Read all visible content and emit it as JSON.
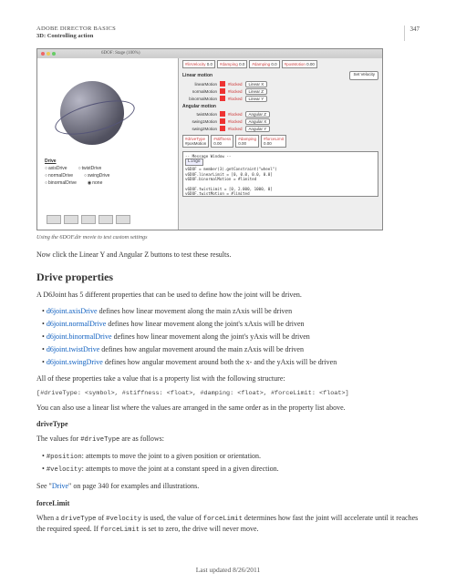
{
  "header": {
    "title": "ADOBE DIRECTOR BASICS",
    "subtitle": "3D: Controlling action",
    "page": "347"
  },
  "screenshot": {
    "window_title": "6DOF: Stage (100%)",
    "readouts": {
      "linVelocity": {
        "label": "#linVelocity",
        "val": "0.0"
      },
      "damping1": {
        "label": "#damping",
        "val": "0.0"
      },
      "damping2": {
        "label": "#damping",
        "val": "0.0"
      },
      "posMotion": {
        "label": "#posMotion",
        "val": "0.00"
      }
    },
    "linear": {
      "title": "Linear motion",
      "setBtn": "Set Velocity",
      "rows": [
        {
          "label": "linearMotion",
          "locked": "#locked",
          "btn": "Linear X"
        },
        {
          "label": "normalMotion",
          "locked": "#locked",
          "btn": "Linear Z"
        },
        {
          "label": "binormalMotion",
          "locked": "#locked",
          "btn": "Linear Y"
        }
      ]
    },
    "angular": {
      "title": "Angular motion",
      "rows": [
        {
          "label": "twistMotion",
          "locked": "#locked",
          "btn": "Angular Z"
        },
        {
          "label": "swing1Motion",
          "locked": "#locked",
          "btn": "Angular X"
        },
        {
          "label": "swing2Motion",
          "locked": "#locked",
          "btn": "Angular Y"
        }
      ]
    },
    "drive": {
      "title": "Drive",
      "r1a": "axisDrive",
      "r1b": "twistDrive",
      "r2a": "normalDrive",
      "r2b": "swingDrive",
      "r3a": "binormalDrive",
      "r3b": "none"
    },
    "lower": {
      "driveType": {
        "label": "#driveType",
        "val": "#posMotion"
      },
      "stiffness": {
        "label": "#stiffness",
        "val": "0.00"
      },
      "damping": {
        "label": "#damping",
        "val": "0.00"
      },
      "forceLimit": {
        "label": "#forceLimit",
        "val": "0.00"
      }
    },
    "msg": {
      "title": "-- Message Window --",
      "dropdown": "Lingo",
      "line1": "v6DOF = member(3).getConstraint(\"wheel\")",
      "line2": "v6DOF.linearLimit = [0, 0.0, 0.0, 0.0]",
      "line3": "v6DOF.binormalMotion = #limited",
      "line4": "v6DOF.twistLimit = [0, 2.000, 1000, 0]",
      "line5": "v6DOF.twistMotion = #limited"
    }
  },
  "caption": "Using the 6DOF.dir movie to test custom settings",
  "p_intro": "Now click the Linear Y and Angular Z buttons to test these results.",
  "h2": "Drive properties",
  "p_drive": "A D6Joint has 5 different properties that can be used to define how the joint will be driven.",
  "bullets": [
    {
      "link": "d6joint.axisDrive",
      "text": " defines how linear movement along the main zAxis will be driven"
    },
    {
      "link": "d6joint.normalDrive",
      "text": " defines how linear movement along the joint's xAxis will be driven"
    },
    {
      "link": "d6joint.binormalDrive",
      "text": " defines how linear movement along the joint's yAxis will be driven"
    },
    {
      "link": "d6joint.twistDrive",
      "text": " defines how angular movement around the main zAxis will be driven"
    },
    {
      "link": "d6joint.swingDrive",
      "text": " defines how angular movement around both the x- and the yAxis will be driven"
    }
  ],
  "p_allprops": "All of these properties take a value that is a property list with the following structure:",
  "code_struct": "[#driveType: <symbol>, #stiffness: <float>, #damping: <float>, #forceLimit: <float>]",
  "p_linear": "You can also use a linear list where the values are arranged in the same order as in the property list above.",
  "subhead1": "driveType",
  "p_values": "The values for ",
  "code_dt": "#driveType",
  "p_values2": " are as follows:",
  "bullets2": [
    {
      "code": "#position",
      "text": ": attempts to move the joint to a given position or orientation."
    },
    {
      "code": "#velocity",
      "text": ": attempts to move the joint at a constant speed in a given direction."
    }
  ],
  "p_see": "See \"",
  "seelink": "Drive",
  "p_see2": "\" on page 340 for examples and illustrations.",
  "subhead2": "forceLimit",
  "p_force": "When a ",
  "code_dt2": "driveType",
  "p_force2": " of ",
  "code_vel": "#velocity",
  "p_force3": " is used, the value of ",
  "code_fl": "forceLimit",
  "p_force4": " determines how fast the joint will accelerate until it reaches the required speed. If ",
  "code_fl2": "forceLimit",
  "p_force5": " is set to zero, the drive will never move.",
  "footer": "Last updated 8/26/2011"
}
